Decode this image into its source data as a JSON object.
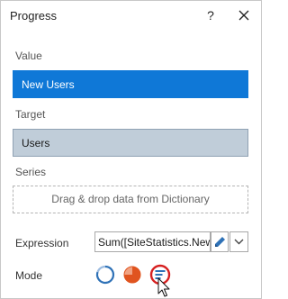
{
  "dialog": {
    "title": "Progress",
    "help_label": "?"
  },
  "sections": {
    "value_label": "Value",
    "value_field": "New Users",
    "target_label": "Target",
    "target_field": "Users",
    "series_label": "Series",
    "series_drop": "Drag & drop data from Dictionary"
  },
  "expression": {
    "label": "Expression",
    "value": "Sum([SiteStatistics.New U"
  },
  "mode": {
    "label": "Mode",
    "options": [
      "circle-mode-icon",
      "pie-mode-icon",
      "data-bars-mode-icon"
    ]
  },
  "colors": {
    "accent": "#0f78d7",
    "target_fill": "#c0cdd9",
    "mode_icon_blue": "#2f72b7",
    "mode_icon_orange": "#e0541f",
    "highlight_ring": "#d62020"
  }
}
